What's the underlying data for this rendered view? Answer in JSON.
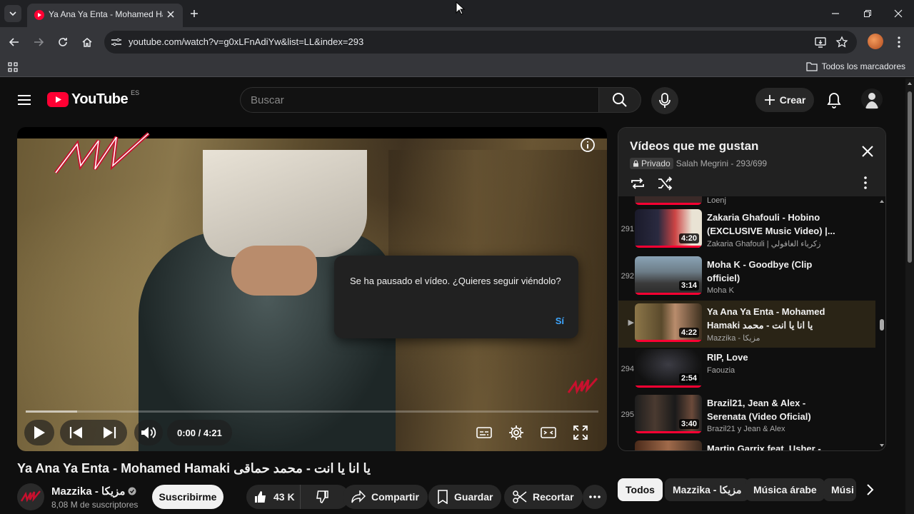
{
  "browser": {
    "tab_title": "Ya Ana Ya Enta - Mohamed Hamaki",
    "url": "youtube.com/watch?v=g0xLFnAdiYw&list=LL&index=293",
    "bookmarks_all": "Todos los marcadores"
  },
  "header": {
    "logo_text": "YouTube",
    "country_code": "ES",
    "search_placeholder": "Buscar",
    "create_label": "Crear"
  },
  "player": {
    "time": "0:00 / 4:21",
    "progress_loaded": 0.09,
    "paused_message": "Se ha pausado el vídeo. ¿Quieres seguir viéndolo?",
    "paused_yes": "Sí"
  },
  "video": {
    "title": "Ya Ana Ya Enta - Mohamed Hamaki يا انا يا انت - محمد حماقى",
    "channel": "Mazzika - مزيكا",
    "subscribers": "8,08 M de suscriptores",
    "subscribe_label": "Suscribirme",
    "likes": "43 K",
    "share_label": "Compartir",
    "save_label": "Guardar",
    "clip_label": "Recortar"
  },
  "playlist": {
    "title": "Vídeos que me gustan",
    "private_label": "Privado",
    "owner_progress": "Salah Megrini - 293/699",
    "prev_channel": "Loenj",
    "items": [
      {
        "index": "291",
        "title": "Zakaria Ghafouli - Hobino (EXCLUSIVE Music Video) |...",
        "channel": "Zakaria Ghafouli | زكرياء الغافولي",
        "duration": "4:20"
      },
      {
        "index": "292",
        "title": "Moha K - Goodbye (Clip officiel)",
        "channel": "Moha K",
        "duration": "3:14"
      },
      {
        "index": "▶",
        "title": "Ya Ana Ya Enta - Mohamed Hamaki يا انا يا انت - محمد حماقى",
        "channel": "Mazzika - مزيكا",
        "duration": "4:22"
      },
      {
        "index": "294",
        "title": "RIP, Love",
        "channel": "Faouzia",
        "duration": "2:54"
      },
      {
        "index": "295",
        "title": "Brazil21, Jean & Alex - Serenata (Video Oficial)",
        "channel": "Brazil21 y Jean & Alex",
        "duration": "3:40"
      },
      {
        "index": "",
        "title": "Martin Garrix feat. Usher -",
        "channel": "",
        "duration": ""
      }
    ]
  },
  "chips": [
    "Todos",
    "Mazzika - مزيكا",
    "Música árabe",
    "Músi"
  ],
  "colors": {
    "accent": "#ff0033",
    "link": "#3ea6ff"
  }
}
